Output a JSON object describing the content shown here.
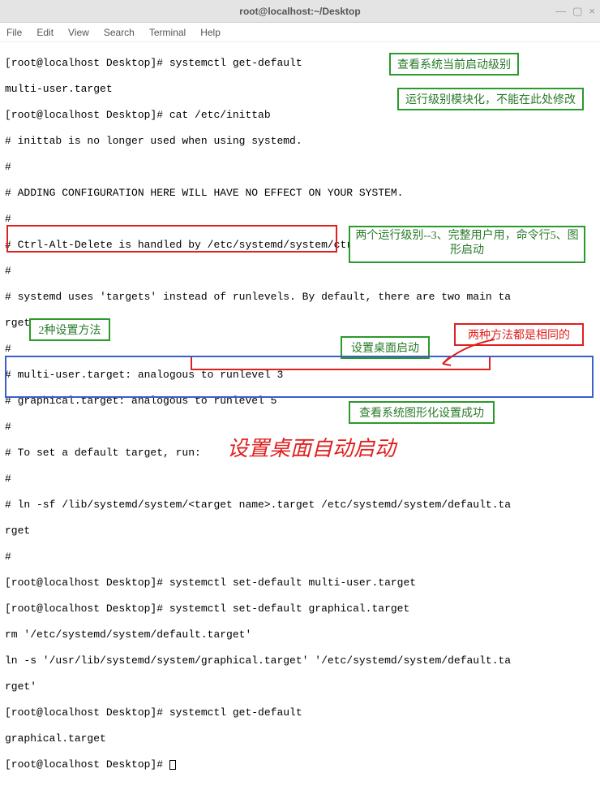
{
  "window": {
    "title": "root@localhost:~/Desktop",
    "controls": {
      "min": "—",
      "max": "▢",
      "close": "×"
    }
  },
  "menu": {
    "file": "File",
    "edit": "Edit",
    "view": "View",
    "search": "Search",
    "terminal": "Terminal",
    "help": "Help"
  },
  "term": {
    "l1": "[root@localhost Desktop]# systemctl get-default",
    "l2": "multi-user.target",
    "l3": "[root@localhost Desktop]# cat /etc/inittab",
    "l4": "# inittab is no longer used when using systemd.",
    "l5": "#",
    "l6": "# ADDING CONFIGURATION HERE WILL HAVE NO EFFECT ON YOUR SYSTEM.",
    "l7": "#",
    "l8": "# Ctrl-Alt-Delete is handled by /etc/systemd/system/ctrl-alt-del.target",
    "l9": "#",
    "l10": "# systemd uses 'targets' instead of runlevels. By default, there are two main ta",
    "l11": "rgets:",
    "l12": "#",
    "l13": "# multi-user.target: analogous to runlevel 3",
    "l14": "# graphical.target: analogous to runlevel 5",
    "l15": "#",
    "l16": "# To set a default target, run:",
    "l17": "#",
    "l18": "# ln -sf /lib/systemd/system/<target name>.target /etc/systemd/system/default.ta",
    "l19": "rget",
    "l20": "#",
    "l21": "[root@localhost Desktop]# systemctl set-default multi-user.target",
    "l22": "[root@localhost Desktop]# systemctl set-default graphical.target",
    "l23": "rm '/etc/systemd/system/default.target'",
    "l24": "ln -s '/usr/lib/systemd/system/graphical.target' '/etc/systemd/system/default.ta",
    "l25": "rget'",
    "l26": "[root@localhost Desktop]# systemctl get-default",
    "l27": "graphical.target",
    "l28": "[root@localhost Desktop]# "
  },
  "annot": {
    "a1": "查看系统当前启动级别",
    "a2": "运行级别模块化，不能在此处修改",
    "a3": "两个运行级别--3、完整用户用，命令行5、图形启动",
    "a4": "2种设置方法",
    "a5": "设置桌面启动",
    "a6": "两种方法都是相同的",
    "a7": "查看系统图形化设置成功",
    "big": "设置桌面自动启动"
  }
}
